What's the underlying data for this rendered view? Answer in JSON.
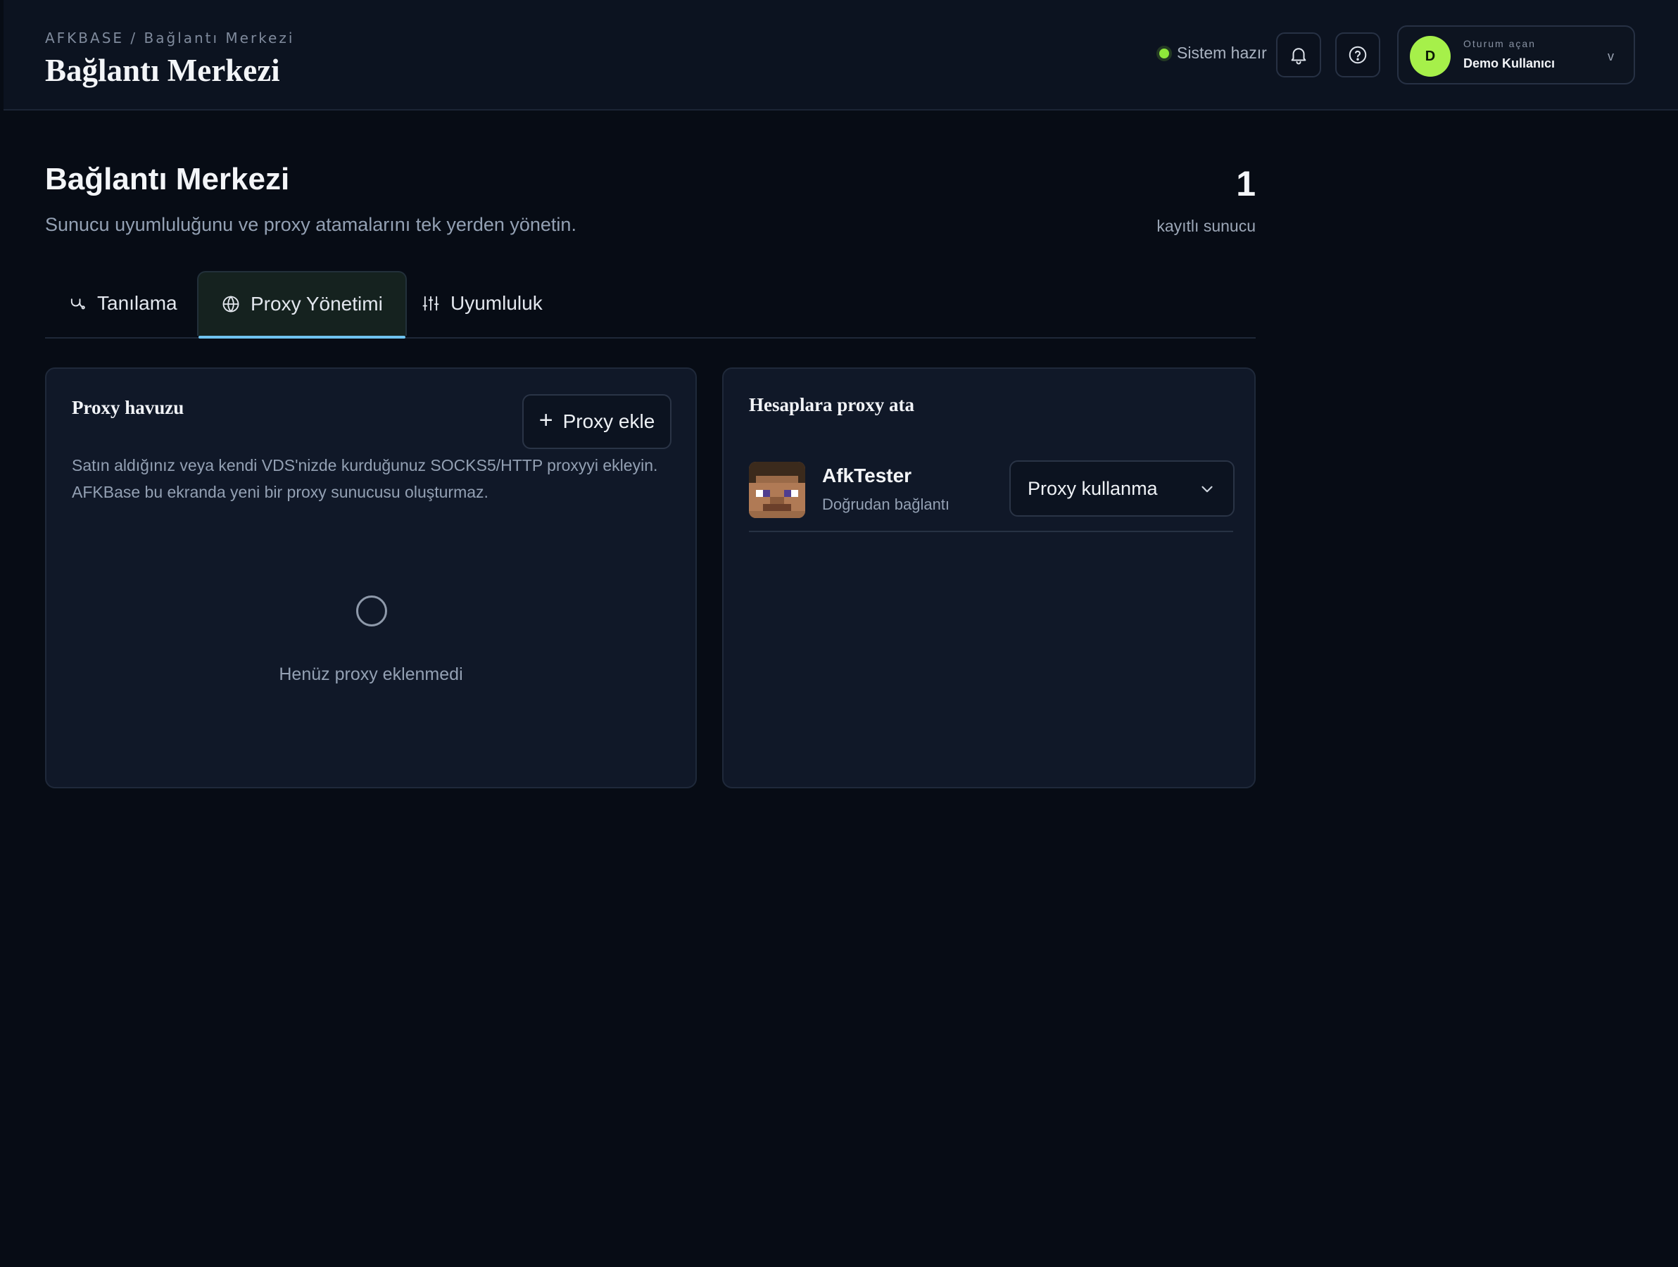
{
  "breadcrumb": "AFKBASE / Bağlantı Merkezi",
  "topbar": {
    "title": "Bağlantı Merkezi",
    "status": "Sistem hazır",
    "status_color": "#8fe83a",
    "notifications_icon": "bell-icon",
    "help_icon": "help-circle-icon"
  },
  "user": {
    "initial": "D",
    "caption": "Oturum açan",
    "name": "Demo Kullanıcı",
    "chevron": "v",
    "avatar_color": "#a6f04a"
  },
  "page": {
    "title": "Bağlantı Merkezi",
    "subtitle": "Sunucu uyumluluğunu ve proxy atamalarını tek yerden yönetin.",
    "server_count": "1",
    "server_count_label": "kayıtlı sunucu"
  },
  "tabs": [
    {
      "label": "Tanılama",
      "icon": "stethoscope-icon",
      "active": false
    },
    {
      "label": "Proxy Yönetimi",
      "icon": "globe-icon",
      "active": true
    },
    {
      "label": "Uyumluluk",
      "icon": "sliders-icon",
      "active": false
    }
  ],
  "proxy_pool": {
    "title": "Proxy havuzu",
    "add_button": "Proxy ekle",
    "description": "Satın aldığınız veya kendi VDS'nizde kurduğunuz SOCKS5/HTTP proxyyi ekleyin. AFKBase bu ekranda yeni bir proxy sunucusu oluşturmaz.",
    "empty_text": "Henüz proxy eklenmedi"
  },
  "assign": {
    "title": "Hesaplara proxy ata",
    "accounts": [
      {
        "name": "AfkTester",
        "connection": "Doğrudan bağlantı",
        "proxy": "Proxy kullanma"
      }
    ]
  },
  "colors": {
    "background": "#070c15",
    "card": "#101828",
    "accent_tab": "#6fc3f0"
  }
}
